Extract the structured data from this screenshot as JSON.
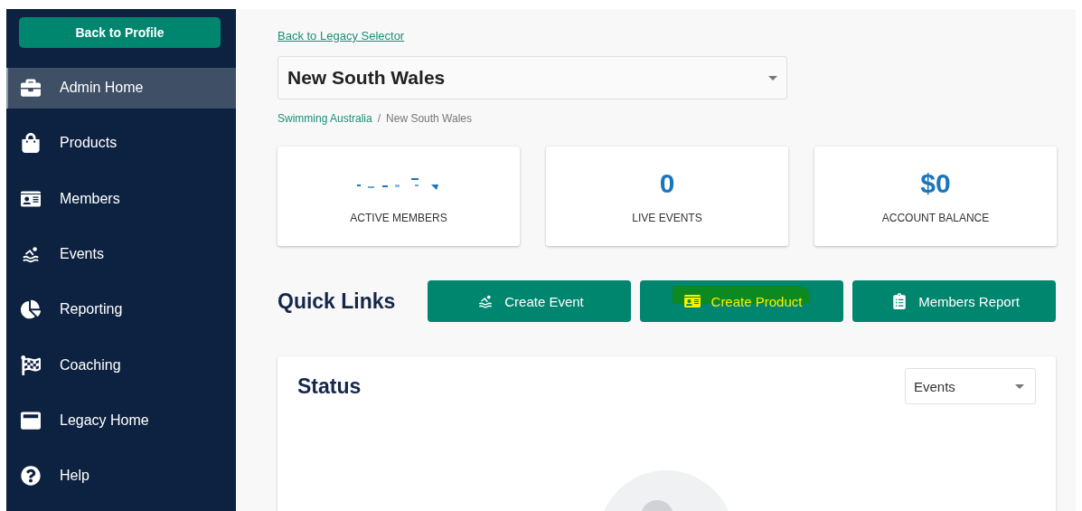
{
  "sidebar": {
    "back_button": "Back to Profile",
    "items": [
      {
        "label": "Admin Home",
        "selected": true
      },
      {
        "label": "Products",
        "selected": false
      },
      {
        "label": "Members",
        "selected": false
      },
      {
        "label": "Events",
        "selected": false
      },
      {
        "label": "Reporting",
        "selected": false
      },
      {
        "label": "Coaching",
        "selected": false
      },
      {
        "label": "Legacy Home",
        "selected": false
      },
      {
        "label": "Help",
        "selected": false
      }
    ]
  },
  "back_link": "Back to Legacy Selector",
  "organisation_select": {
    "value": "New South Wales"
  },
  "breadcrumb": {
    "separator": "/",
    "items": [
      {
        "label": "Swimming Australia",
        "link": true
      },
      {
        "label": "New South Wales",
        "link": false
      }
    ]
  },
  "stats": [
    {
      "value_redacted": true,
      "label": "ACTIVE MEMBERS"
    },
    {
      "value": "0",
      "label": "LIVE EVENTS"
    },
    {
      "value": "$0",
      "label": "ACCOUNT BALANCE"
    }
  ],
  "quick_links": {
    "title": "Quick Links",
    "buttons": [
      {
        "label": "Create Event",
        "highlighted": false
      },
      {
        "label": "Create Product",
        "highlighted": true
      },
      {
        "label": "Members Report",
        "highlighted": false
      }
    ]
  },
  "status": {
    "title": "Status",
    "select": {
      "value": "Events"
    }
  }
}
